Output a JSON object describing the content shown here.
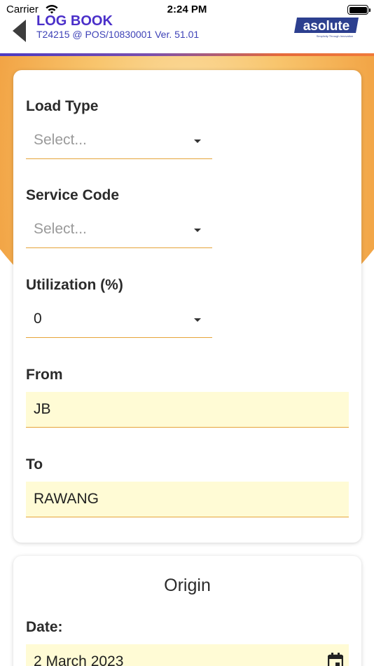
{
  "status_bar": {
    "carrier": "Carrier",
    "time": "2:24 PM"
  },
  "header": {
    "title": "LOG BOOK",
    "subtitle": "T24215 @ POS/10830001 Ver. 51.01",
    "logo_text": "asolute",
    "logo_tagline": "Simplicity Through Innovation"
  },
  "form": {
    "load_type": {
      "label": "Load Type",
      "placeholder": "Select...",
      "value": ""
    },
    "service_code": {
      "label": "Service Code",
      "placeholder": "Select...",
      "value": ""
    },
    "utilization": {
      "label": "Utilization (%)",
      "value": "0"
    },
    "from": {
      "label": "From",
      "value": "JB"
    },
    "to": {
      "label": "To",
      "value": "RAWANG"
    }
  },
  "origin": {
    "title": "Origin",
    "date_label": "Date:",
    "date_value": "2 March 2023"
  },
  "colors": {
    "brand": "#4a2fc9",
    "field_underline": "#e6a43a",
    "field_fill": "#fffbd5"
  },
  "icons": [
    "back-arrow-icon",
    "wifi-icon",
    "battery-icon",
    "caret-down-icon",
    "calendar-icon"
  ]
}
